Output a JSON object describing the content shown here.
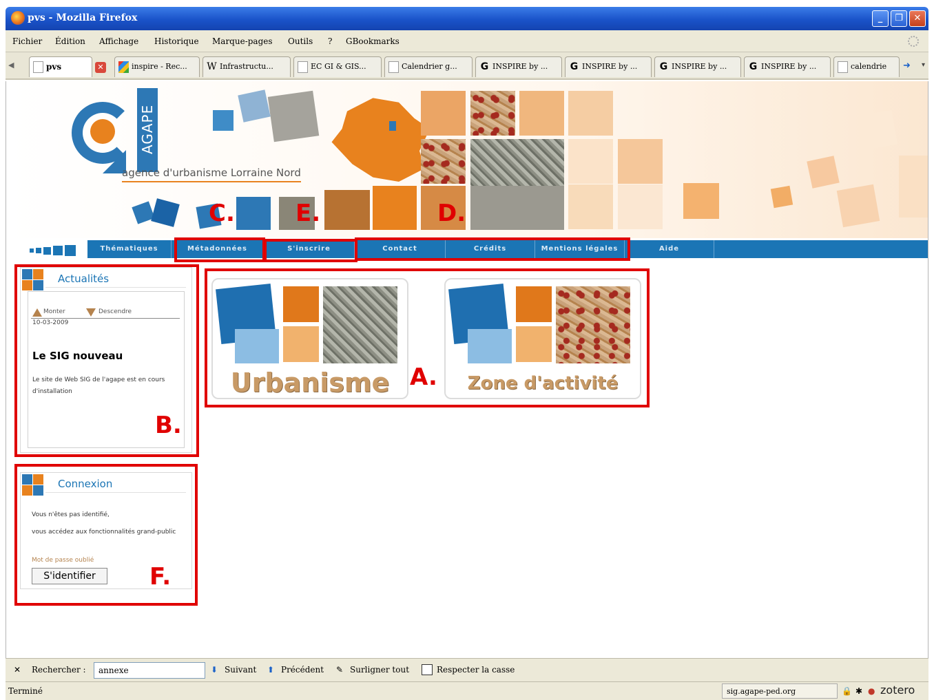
{
  "window": {
    "title": "pvs - Mozilla Firefox",
    "minimize": "_",
    "maximize": "❐",
    "close": "✕"
  },
  "menubar": {
    "items": [
      "Fichier",
      "Édition",
      "Affichage",
      "Historique",
      "Marque-pages",
      "Outils",
      "?",
      "GBookmarks"
    ]
  },
  "tabs": [
    {
      "label": "pvs",
      "icon": "page-icon",
      "active": true
    },
    {
      "label": "inspire - Rec...",
      "icon": "inspire-icon"
    },
    {
      "label": "Infrastructu...",
      "icon": "wikipedia-icon"
    },
    {
      "label": "EC GI & GIS...",
      "icon": "page-icon"
    },
    {
      "label": "Calendrier g...",
      "icon": "page-icon"
    },
    {
      "label": "INSPIRE by ...",
      "icon": "google-icon"
    },
    {
      "label": "INSPIRE by ...",
      "icon": "google-icon"
    },
    {
      "label": "INSPIRE by ...",
      "icon": "google-icon"
    },
    {
      "label": "INSPIRE by ...",
      "icon": "google-icon"
    },
    {
      "label": "calendrie",
      "icon": "page-icon"
    }
  ],
  "banner": {
    "logo_text": "AGAPE",
    "tagline": "agence d'urbanisme Lorraine Nord"
  },
  "nav": {
    "items": [
      "Thématiques",
      "Métadonnées",
      "S'inscrire",
      "Contact",
      "Crédits",
      "Mentions légales",
      "Aide"
    ]
  },
  "markers": {
    "a": "A.",
    "b": "B.",
    "c": "C.",
    "d": "D.",
    "e": "E.",
    "f": "F."
  },
  "news": {
    "title": "Actualités",
    "up_label": "Monter",
    "down_label": "Descendre",
    "date": "10-03-2009",
    "headline": "Le SIG nouveau",
    "body": "Le site de Web SIG de l'agape est en cours d'installation"
  },
  "login": {
    "title": "Connexion",
    "line1": "Vous n'êtes pas identifié,",
    "line2": "vous accédez aux fonctionnalités grand-public",
    "forgot": "Mot de passe oublié",
    "button": "S'identifier"
  },
  "tiles": [
    {
      "label": "Urbanisme"
    },
    {
      "label": "Zone d'activité"
    }
  ],
  "findbar": {
    "close": "✕",
    "label": "Rechercher :",
    "value": "annexe",
    "next": "Suivant",
    "previous": "Précédent",
    "highlight": "Surligner tout",
    "match_case": "Respecter la casse"
  },
  "statusbar": {
    "status": "Terminé",
    "url": "sig.agape-ped.org",
    "zotero": "zotero"
  },
  "colors": {
    "accent_blue": "#1b75b5",
    "accent_orange": "#e8821e",
    "annotation_red": "#e00000"
  }
}
